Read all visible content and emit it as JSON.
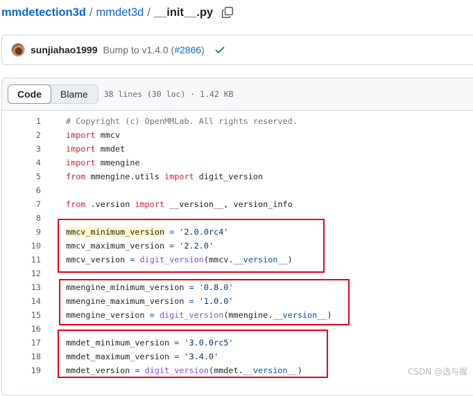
{
  "breadcrumb": {
    "repo": "mmdetection3d",
    "folder": "mmdet3d",
    "file": "__init__.py",
    "separator": "/"
  },
  "commit": {
    "author": "sunjiahao1999",
    "message_prefix": "Bump to v1.4.0 (",
    "pr": "#2866",
    "message_suffix": ")",
    "status_icon": "check-icon"
  },
  "file_view": {
    "tabs": [
      "Code",
      "Blame"
    ],
    "active_tab": "Code",
    "meta": "38 lines (30 loc) · 1.42 KB"
  },
  "code_lines": [
    {
      "n": "1",
      "tokens": [
        {
          "t": "# Copyright (c) OpenMMLab. All rights reserved.",
          "c": "cm"
        }
      ]
    },
    {
      "n": "2",
      "tokens": [
        {
          "t": "import",
          "c": "kw"
        },
        {
          "t": " mmcv",
          "c": ""
        }
      ]
    },
    {
      "n": "3",
      "tokens": [
        {
          "t": "import",
          "c": "kw"
        },
        {
          "t": " mmdet",
          "c": ""
        }
      ]
    },
    {
      "n": "4",
      "tokens": [
        {
          "t": "import",
          "c": "kw"
        },
        {
          "t": " mmengine",
          "c": ""
        }
      ]
    },
    {
      "n": "5",
      "tokens": [
        {
          "t": "from",
          "c": "kw"
        },
        {
          "t": " mmengine.utils ",
          "c": ""
        },
        {
          "t": "import",
          "c": "kw"
        },
        {
          "t": " digit_version",
          "c": ""
        }
      ]
    },
    {
      "n": "6",
      "tokens": []
    },
    {
      "n": "7",
      "tokens": [
        {
          "t": "from",
          "c": "kw"
        },
        {
          "t": " .version ",
          "c": ""
        },
        {
          "t": "import",
          "c": "kw"
        },
        {
          "t": " __version__, version_info",
          "c": ""
        }
      ]
    },
    {
      "n": "8",
      "tokens": []
    },
    {
      "n": "9",
      "tokens": [
        {
          "t": "mmcv_minimum_version",
          "c": "hl"
        },
        {
          "t": " ",
          "c": ""
        },
        {
          "t": "=",
          "c": "op"
        },
        {
          "t": " ",
          "c": ""
        },
        {
          "t": "'2.0.0rc4'",
          "c": "str"
        }
      ]
    },
    {
      "n": "10",
      "tokens": [
        {
          "t": "mmcv_maximum_version ",
          "c": ""
        },
        {
          "t": "=",
          "c": "op"
        },
        {
          "t": " ",
          "c": ""
        },
        {
          "t": "'2.2.0'",
          "c": "str"
        }
      ]
    },
    {
      "n": "11",
      "tokens": [
        {
          "t": "mmcv_version ",
          "c": ""
        },
        {
          "t": "=",
          "c": "op"
        },
        {
          "t": " ",
          "c": ""
        },
        {
          "t": "digit_version",
          "c": "fn"
        },
        {
          "t": "(mmcv.",
          "c": ""
        },
        {
          "t": "__version__",
          "c": "dunder"
        },
        {
          "t": ")",
          "c": ""
        }
      ]
    },
    {
      "n": "12",
      "tokens": []
    },
    {
      "n": "13",
      "tokens": [
        {
          "t": "mmengine_minimum_version ",
          "c": ""
        },
        {
          "t": "=",
          "c": "op"
        },
        {
          "t": " ",
          "c": ""
        },
        {
          "t": "'0.8.0'",
          "c": "str"
        }
      ]
    },
    {
      "n": "14",
      "tokens": [
        {
          "t": "mmengine_maximum_version ",
          "c": ""
        },
        {
          "t": "=",
          "c": "op"
        },
        {
          "t": " ",
          "c": ""
        },
        {
          "t": "'1.0.0'",
          "c": "str"
        }
      ]
    },
    {
      "n": "15",
      "tokens": [
        {
          "t": "mmengine_version ",
          "c": ""
        },
        {
          "t": "=",
          "c": "op"
        },
        {
          "t": " ",
          "c": ""
        },
        {
          "t": "digit_version",
          "c": "fn"
        },
        {
          "t": "(mmengine.",
          "c": ""
        },
        {
          "t": "__version__",
          "c": "dunder"
        },
        {
          "t": ")",
          "c": ""
        }
      ]
    },
    {
      "n": "16",
      "tokens": []
    },
    {
      "n": "17",
      "tokens": [
        {
          "t": "mmdet_minimum_version ",
          "c": ""
        },
        {
          "t": "=",
          "c": "op"
        },
        {
          "t": " ",
          "c": ""
        },
        {
          "t": "'3.0.0rc5'",
          "c": "str"
        }
      ]
    },
    {
      "n": "18",
      "tokens": [
        {
          "t": "mmdet_maximum_version ",
          "c": ""
        },
        {
          "t": "=",
          "c": "op"
        },
        {
          "t": " ",
          "c": ""
        },
        {
          "t": "'3.4.0'",
          "c": "str"
        }
      ]
    },
    {
      "n": "19",
      "tokens": [
        {
          "t": "mmdet_version ",
          "c": ""
        },
        {
          "t": "=",
          "c": "op"
        },
        {
          "t": " ",
          "c": ""
        },
        {
          "t": "digit_version",
          "c": "fn"
        },
        {
          "t": "(mmdet.",
          "c": ""
        },
        {
          "t": "__version__",
          "c": "dunder"
        },
        {
          "t": ")",
          "c": ""
        }
      ]
    }
  ],
  "annotation_color": "#e60012",
  "watermark": "CSDN @选与握"
}
